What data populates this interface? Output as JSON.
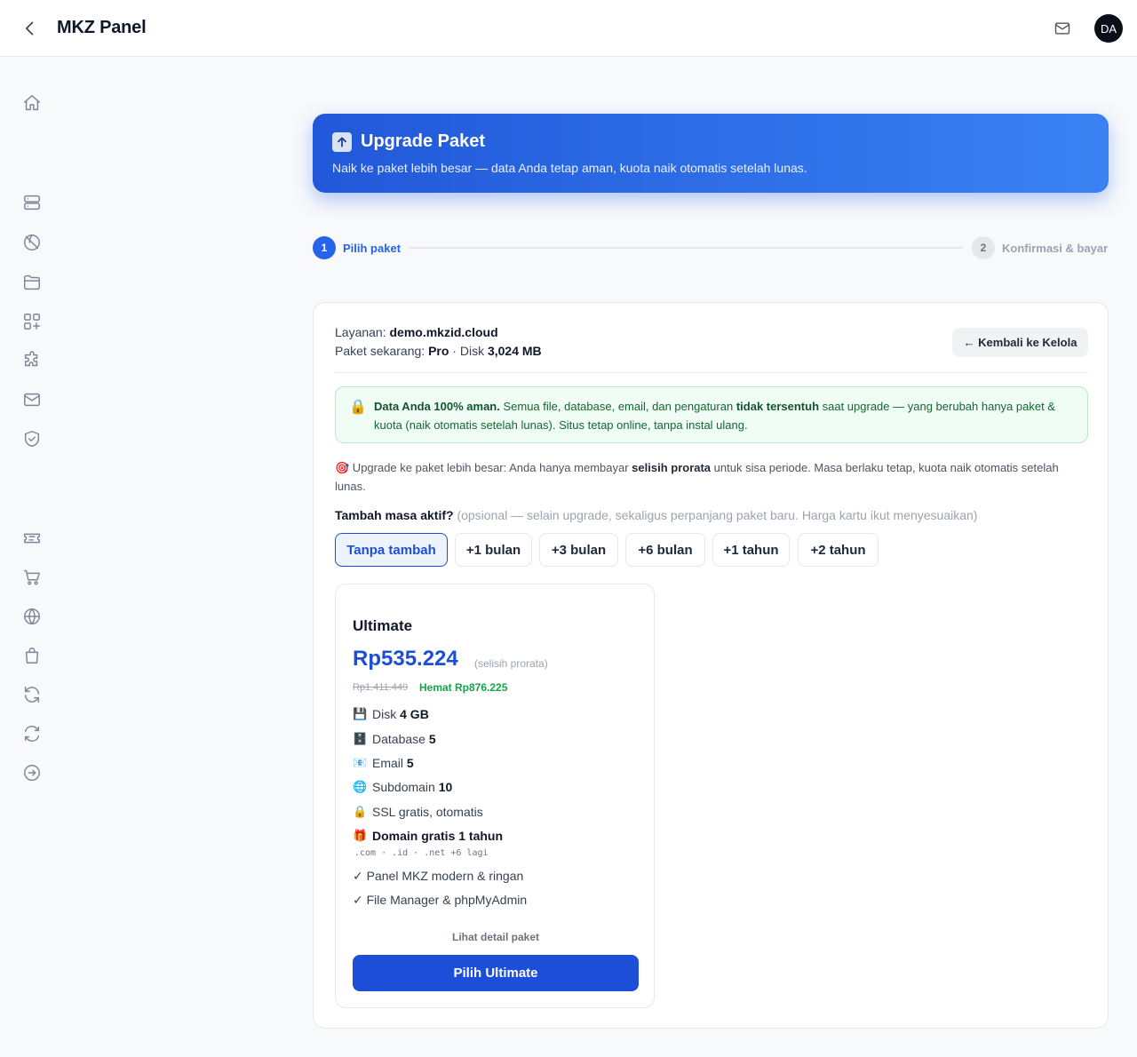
{
  "app": {
    "title": "MKZ Panel",
    "avatar_initials": "DA"
  },
  "sidebar": {
    "icons": [
      "home-icon",
      "server-icon",
      "globe-off-icon",
      "folder-icon",
      "apps-icon",
      "puzzle-icon",
      "mail-icon",
      "shield-check-icon",
      "ticket-icon",
      "cart-icon",
      "globe-icon",
      "shopping-bag-icon",
      "refresh-icon",
      "renew-icon",
      "logout-icon"
    ]
  },
  "banner": {
    "title": "Upgrade Paket",
    "subtitle": "Naik ke paket lebih besar — data Anda tetap aman, kuota naik otomatis setelah lunas."
  },
  "stepper": {
    "step1": {
      "number": "1",
      "label": "Pilih paket"
    },
    "step2": {
      "number": "2",
      "label": "Konfirmasi & bayar"
    }
  },
  "service": {
    "label_layanan": "Layanan:",
    "domain": "demo.mkzid.cloud",
    "label_paket": "Paket sekarang:",
    "current_plan": "Pro",
    "disk_label": "· Disk",
    "disk_value": "3,024 MB",
    "back_button": "← Kembali ke Kelola"
  },
  "safe_notice": {
    "bold1": "Data Anda 100% aman.",
    "text1": " Semua file, database, email, dan pengaturan ",
    "bold2": "tidak tersentuh",
    "text2": " saat upgrade — yang berubah hanya paket & kuota (naik otomatis setelah lunas). Situs tetap online, tanpa instal ulang."
  },
  "prorata_note": {
    "emoji": "🎯",
    "text1": " Upgrade ke paket lebih besar: Anda hanya membayar ",
    "bold": "selisih prorata",
    "text2": " untuk sisa periode. Masa berlaku tetap, kuota naik otomatis setelah lunas."
  },
  "extend": {
    "label": "Tambah masa aktif?",
    "hint": " (opsional — selain upgrade, sekaligus perpanjang paket baru. Harga kartu ikut menyesuaikan)",
    "options": [
      "Tanpa tambah",
      "+1 bulan",
      "+3 bulan",
      "+6 bulan",
      "+1 tahun",
      "+2 tahun"
    ],
    "selected": "Tanpa tambah"
  },
  "package": {
    "name": "Ultimate",
    "price": "Rp535.224",
    "price_note": "(selisih prorata)",
    "old_price": "Rp1.411.449",
    "savings": "Hemat Rp876.225",
    "features": [
      {
        "emoji": "💾",
        "label": "Disk ",
        "value": "4 GB"
      },
      {
        "emoji": "🗄️",
        "label": "Database ",
        "value": "5"
      },
      {
        "emoji": "📧",
        "label": "Email ",
        "value": "5"
      },
      {
        "emoji": "🌐",
        "label": "Subdomain ",
        "value": "10"
      },
      {
        "emoji": "🔒",
        "label": "SSL gratis, otomatis",
        "value": ""
      },
      {
        "emoji": "🎁",
        "label": "",
        "value": "Domain gratis 1 tahun"
      }
    ],
    "tlds": ".com · .id · .net +6 lagi",
    "extras": [
      "✓ Panel MKZ modern & ringan",
      "✓ File Manager & phpMyAdmin"
    ],
    "detail_link": "Lihat detail paket",
    "cta": "Pilih Ultimate"
  },
  "colors": {
    "accent": "#1d4ed8",
    "success": "#16a34a",
    "banner_start": "#2158d9",
    "banner_end": "#3a82f3"
  }
}
